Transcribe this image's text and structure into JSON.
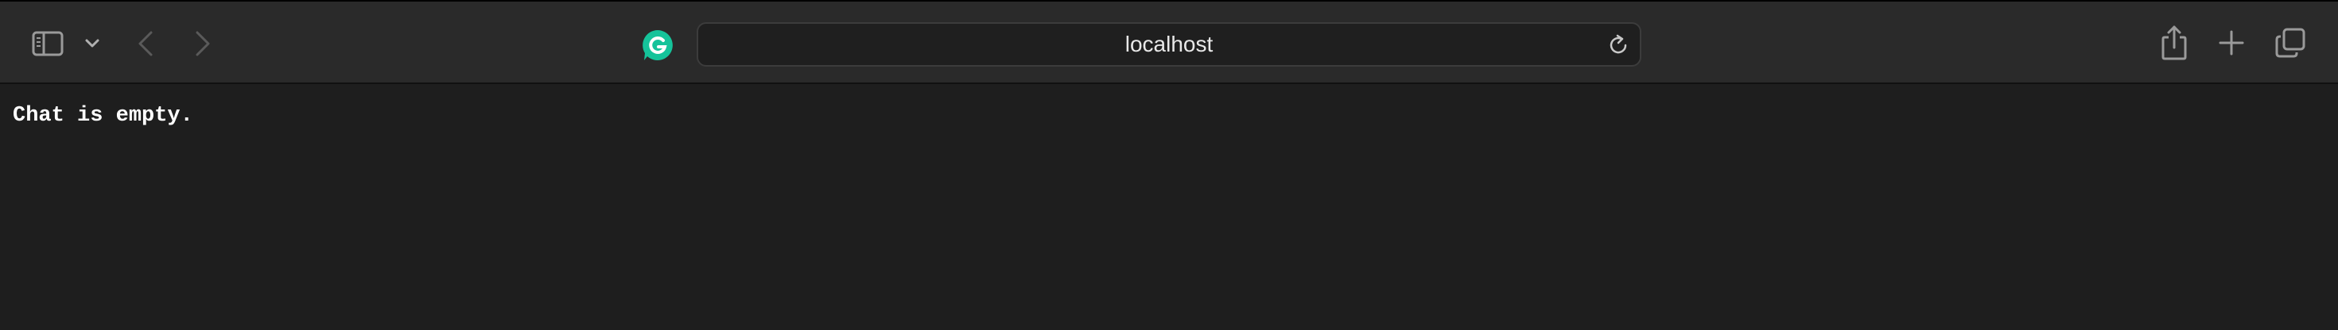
{
  "browser": {
    "address_bar": {
      "url": "localhost"
    },
    "toolbar_icons": [
      "sidebar-icon",
      "chevron-down-icon",
      "back-icon",
      "forward-icon",
      "grammarly-icon",
      "reload-icon",
      "share-icon",
      "plus-icon",
      "tabs-overview-icon"
    ],
    "colors": {
      "toolbar_bg": "#2a2a2a",
      "page_bg": "#1e1e1e",
      "grammarly_green": "#15c39a",
      "text": "#ffffff"
    }
  },
  "page": {
    "message": "Chat is empty."
  }
}
